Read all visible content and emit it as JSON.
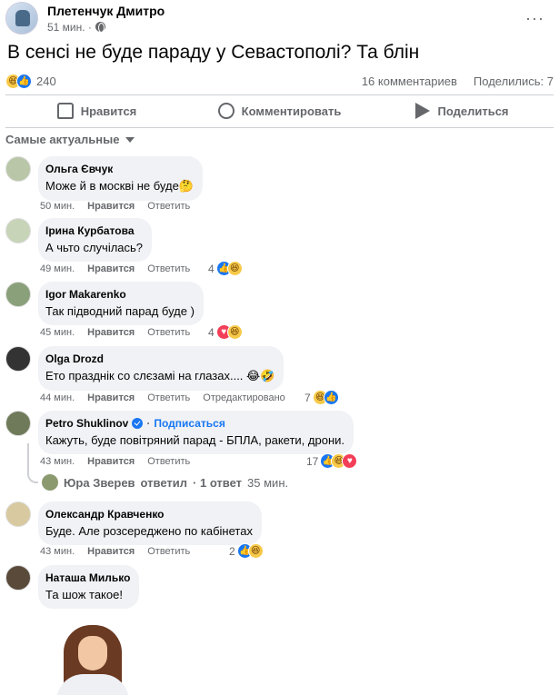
{
  "post": {
    "author": "Плетенчук Дмитро",
    "time": "51 мин. ·",
    "more": "···",
    "text": "В сенсі не буде параду у Севастополі? Та блін",
    "reaction_count": "240",
    "comments_count": "16 комментариев",
    "shares_count": "Поделились: 7"
  },
  "actions": {
    "like": "Нравится",
    "comment": "Комментировать",
    "share": "Поделиться"
  },
  "sort_label": "Самые актуальные",
  "comments": [
    {
      "name": "Ольга Євчук",
      "text": "Може й в москві не буде",
      "emoji": "🤔",
      "time": "50 мин.",
      "like": "Нравится",
      "reply": "Ответить"
    },
    {
      "name": "Ірина Курбатова",
      "text": "А чьто случілась?",
      "time": "49 мин.",
      "like": "Нравится",
      "reply": "Ответить",
      "react_count": "4"
    },
    {
      "name": "Igor Makarenko",
      "text": "Так підводний парад буде )",
      "time": "45 мин.",
      "like": "Нравится",
      "reply": "Ответить",
      "react_count": "4"
    },
    {
      "name": "Olga Drozd",
      "text": "Ето празднік со слєзамі на глазах....",
      "emoji": "😂🤣",
      "time": "44 мин.",
      "like": "Нравится",
      "reply": "Ответить",
      "edited": "Отредактировано",
      "react_count": "7"
    },
    {
      "name": "Petro Shuklinov",
      "subscribe": "Подписаться",
      "text": "Кажуть, буде повітряний парад - БПЛА, ракети, дрони.",
      "time": "43 мин.",
      "like": "Нравится",
      "reply": "Ответить",
      "react_count": "17"
    },
    {
      "name": "Олександр Кравченко",
      "text": "Буде. Але розсереджено по кабінетах",
      "time": "43 мин.",
      "like": "Нравится",
      "reply": "Ответить",
      "react_count": "2"
    },
    {
      "name": "Наташа Милько",
      "text": "Та шож такое!"
    }
  ],
  "reply_summary": {
    "name": "Юра Зверев",
    "verb": "ответил",
    "count": "· 1 ответ",
    "time": "35 мин."
  },
  "colors": {
    "accent": "#1877f2",
    "bubble": "#f0f2f5",
    "secondary_text": "#65676b"
  }
}
